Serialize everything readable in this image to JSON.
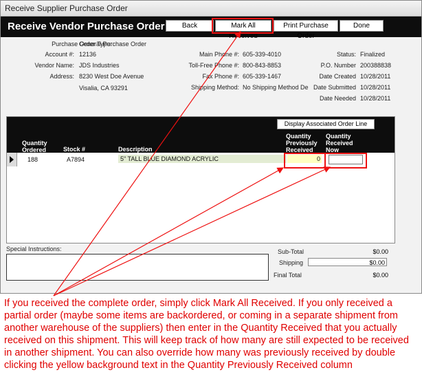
{
  "window": {
    "title": "Receive Supplier Purchase Order"
  },
  "header": {
    "title": "Receive Vendor Purchase Order",
    "buttons": {
      "back": "Back",
      "mark_all": "Mark All Received",
      "print": "Print Purchase Order",
      "done": "Done"
    }
  },
  "info": {
    "po_type_label": "Purchase Order Type:",
    "po_type": "General Purchase Order",
    "account_label": "Account #:",
    "account": "12136",
    "vendor_label": "Vendor Name:",
    "vendor": "JDS Industries",
    "address_label": "Address:",
    "address1": "8230 West Doe Avenue",
    "address2": "Visalia, CA 93291",
    "main_phone_label": "Main Phone #:",
    "main_phone": "605-339-4010",
    "tollfree_label": "Toll-Free Phone #:",
    "tollfree": "800-843-8853",
    "fax_label": "Fax Phone #:",
    "fax": "605-339-1467",
    "ship_label": "Shipping Method:",
    "ship": "No Shipping Method De",
    "status_label": "Status:",
    "status": "Finalized",
    "po_num_label": "P.O. Number",
    "po_num": "200388838",
    "created_label": "Date Created",
    "created": "10/28/2011",
    "submitted_label": "Date Submitted",
    "submitted": "10/28/2011",
    "needed_label": "Date Needed",
    "needed": "10/28/2011"
  },
  "grid": {
    "display_btn": "Display Associated Order Line",
    "headers": {
      "qty_ordered": "Quantity Ordered",
      "stock": "Stock #",
      "desc": "Description",
      "qty_prev": "Quantity Previously Received",
      "qty_now": "Quantity Received Now"
    },
    "row": {
      "qty": "188",
      "stock": "A7894",
      "desc": "5\" TALL BLUE DIAMOND ACRYLIC",
      "prev": "0",
      "now": ""
    }
  },
  "footer": {
    "special_label": "Special Instructions:",
    "subtotal_label": "Sub-Total",
    "subtotal": "$0.00",
    "shipping_label": "Shipping",
    "shipping": "$0.00",
    "final_label": "Final Total",
    "final": "$0.00"
  },
  "annotation": "If you received the complete order, simply click Mark All Received.  If you only received a partial order (maybe some items are backordered, or coming in a separate shipment from another warehouse of the suppliers) then enter in the Quantity Received that you actually received on this shipment.  This will keep track of how many are still expected to be received in another shipment. You can also override how many was previously received by double clicking the yellow background text in the Quantity Previously Received column",
  "colors": {
    "header_bg": "#0d0d0d",
    "highlight": "#e11111",
    "yellow": "#ffffc0",
    "desc_bg": "#e3ecd3"
  }
}
